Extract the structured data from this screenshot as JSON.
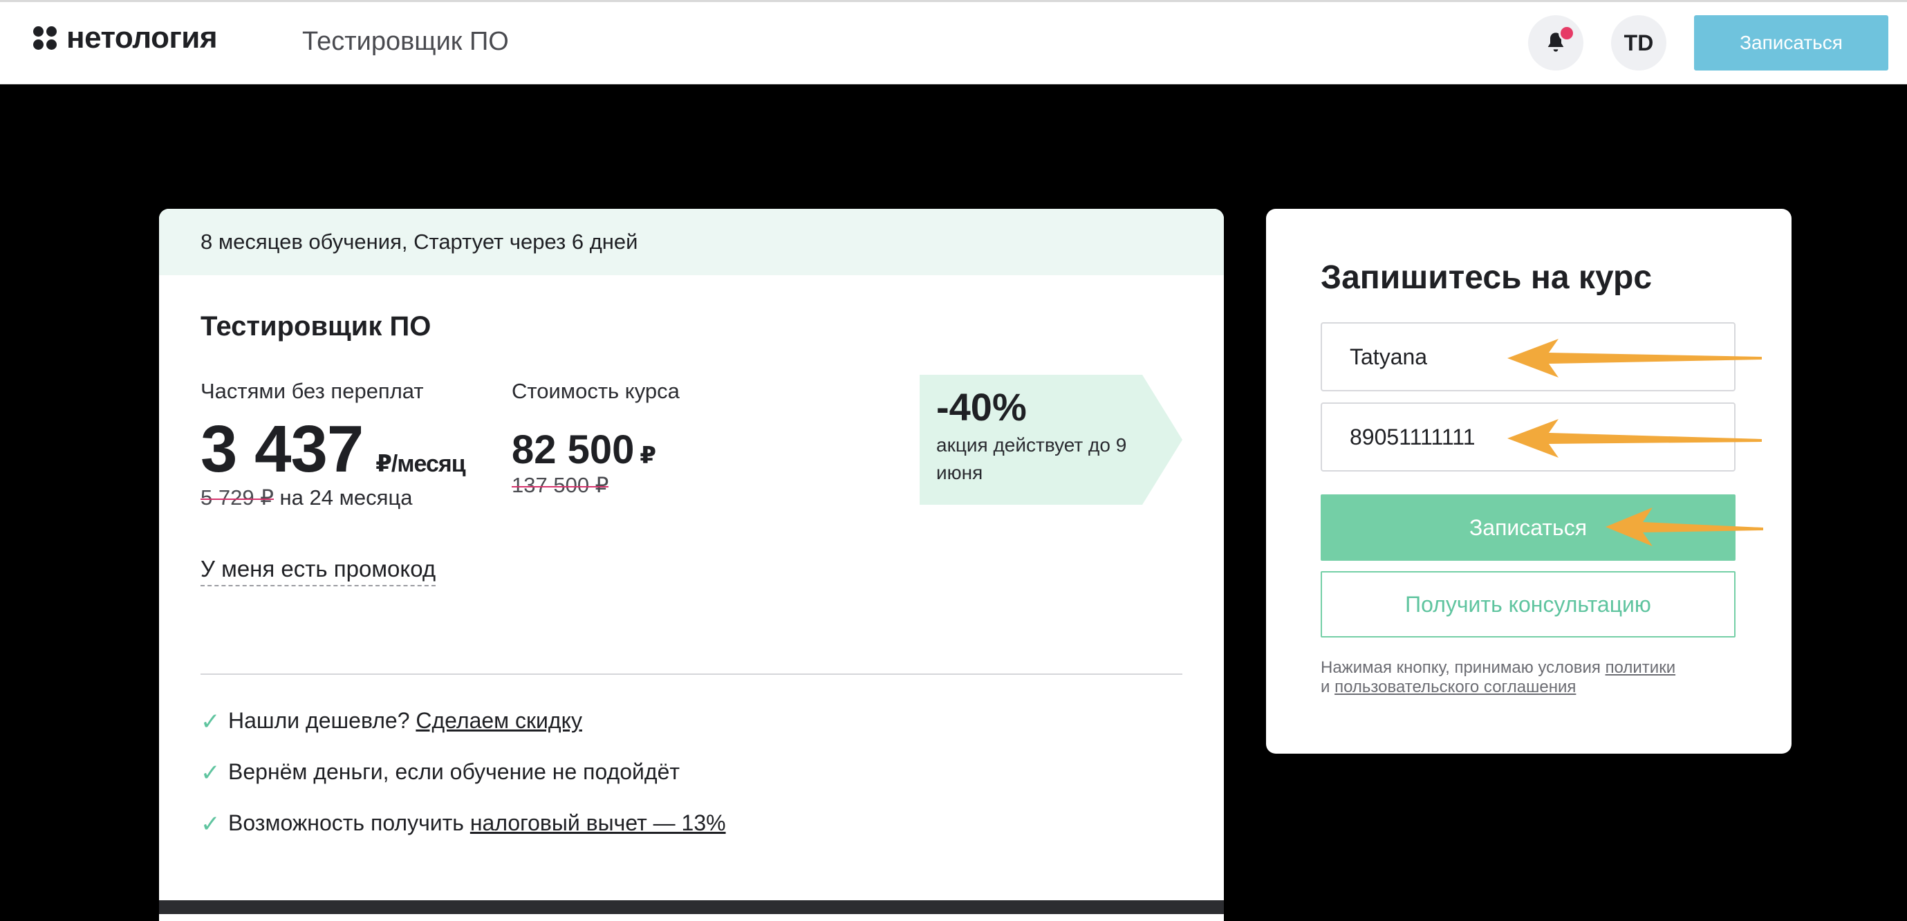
{
  "header": {
    "logo_text": "нетология",
    "course_name": "Тестировщик ПО",
    "avatar_initials": "TD",
    "cta_label": "Записаться",
    "icons": [
      "logo-icon",
      "bell-icon"
    ]
  },
  "course": {
    "meta": "8 месяцев обучения, Стартует через 6 дней",
    "title": "Тестировщик ПО",
    "installment_label": "Частями без переплат",
    "installment_price": "3 437",
    "installment_unit": "₽/месяц",
    "installment_old": "5 729 ₽",
    "installment_term": "на 24 месяца",
    "total_label": "Стоимость курса",
    "total_price": "82 500",
    "total_currency": "₽",
    "total_old": "137 500 ₽",
    "promo_percent": "-40%",
    "promo_text": "акция действует до 9 июня",
    "promo_code_link": "У меня есть промокод",
    "benefits": [
      {
        "prefix": "Нашли дешевле? ",
        "link": "Сделаем скидку"
      },
      {
        "prefix": "Вернём деньги, если обучение не подойдёт",
        "link": ""
      },
      {
        "prefix": "Возможность получить ",
        "link": "налоговый вычет — 13%"
      }
    ]
  },
  "signup": {
    "title": "Запишитесь на курс",
    "name_value": "Tatyana",
    "phone_value": "89051111111",
    "submit_label": "Записаться",
    "consult_label": "Получить консультацию",
    "terms_prefix": "Нажимая кнопку, принимаю условия ",
    "terms_link1": "политики",
    "terms_and": "и ",
    "terms_link2": "пользовательского соглашения"
  },
  "colors": {
    "accent_green": "#74cfa6",
    "header_cta_blue": "#6fc3dd",
    "promo_bg": "#dff4ea",
    "notification_dot": "#e63b66",
    "annotation_arrow": "#f2a93b"
  }
}
